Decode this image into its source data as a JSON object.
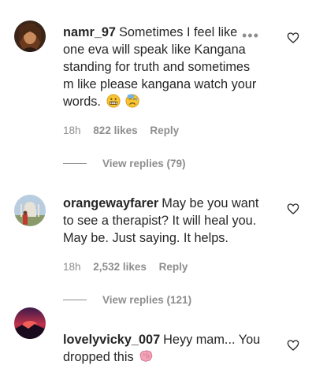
{
  "comments": [
    {
      "username": "namr_97",
      "text_line1": "Sometimes I feel like",
      "text_line2": "one eva will speak like Kangana",
      "text_line3": "standing for truth and sometimes",
      "text_line4": "m like please kangana watch your",
      "text_line5": "words.",
      "time": "18h",
      "likes": "822 likes",
      "reply": "Reply",
      "view_replies": "View replies (79)",
      "more": "•••",
      "avatar_icon": "woman-portrait-avatar",
      "emojis": [
        "grimacing-face-emoji",
        "sad-sweat-face-emoji"
      ]
    },
    {
      "username": "orangewayfarer",
      "text_line1": "May be you want",
      "text_line2": "to see a therapist? It will heal you.",
      "text_line3": "May be. Just saying. It helps.",
      "time": "18h",
      "likes": "2,532 likes",
      "reply": "Reply",
      "view_replies": "View replies (121)",
      "avatar_icon": "taj-mahal-avatar"
    },
    {
      "username": "lovelyvicky_007",
      "text_line1": "Heyy mam... You",
      "text_line2": "dropped this",
      "avatar_icon": "sunset-avatar",
      "emojis": [
        "brain-emoji"
      ]
    }
  ],
  "colors": {
    "text": "#262626",
    "muted": "#8e8e8e"
  }
}
